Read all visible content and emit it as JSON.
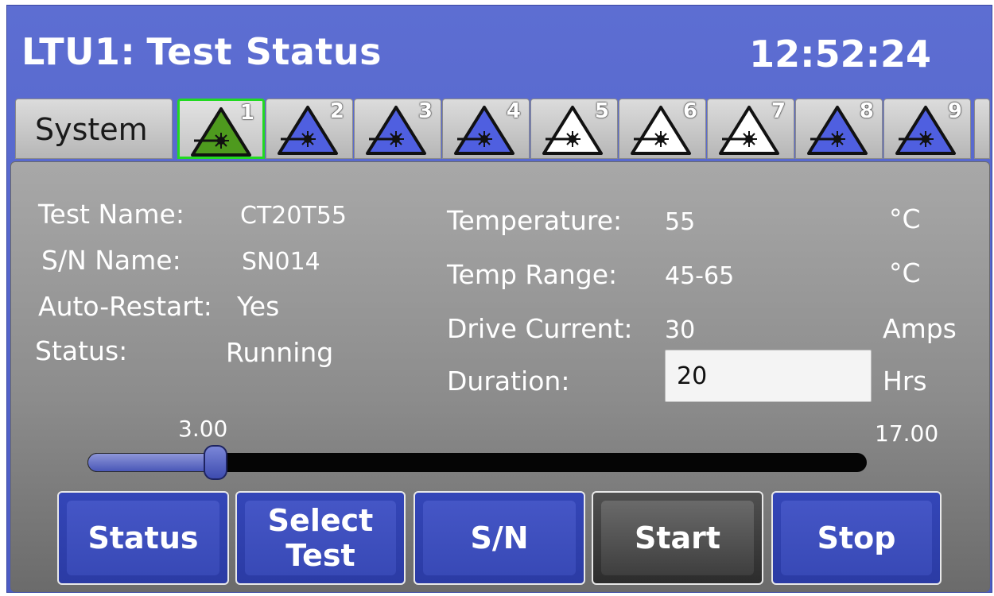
{
  "header": {
    "title_part1": "LTU1:",
    "title_part2": "Test Status",
    "clock": "12:52:24"
  },
  "tabs": {
    "system_label": "System",
    "lasers": [
      {
        "num": "1",
        "color": "#4e9a1e",
        "active": true
      },
      {
        "num": "2",
        "color": "#4f5fe0",
        "active": false
      },
      {
        "num": "3",
        "color": "#4f5fe0",
        "active": false
      },
      {
        "num": "4",
        "color": "#4f5fe0",
        "active": false
      },
      {
        "num": "5",
        "color": "#ffffff",
        "active": false
      },
      {
        "num": "6",
        "color": "#ffffff",
        "active": false
      },
      {
        "num": "7",
        "color": "#ffffff",
        "active": false
      },
      {
        "num": "8",
        "color": "#4f5fe0",
        "active": false
      },
      {
        "num": "9",
        "color": "#4f5fe0",
        "active": false
      }
    ],
    "laser_icon": "laser-warning-icon"
  },
  "info": {
    "test_name_label": "Test Name:",
    "test_name_value": "CT20T55",
    "sn_label": "S/N Name:",
    "sn_value": "SN014",
    "auto_restart_label": "Auto-Restart:",
    "auto_restart_value": "Yes",
    "status_label": "Status:",
    "status_value": "Running"
  },
  "params": {
    "temperature_label": "Temperature:",
    "temperature_value": "55",
    "temperature_unit": "°C",
    "temp_range_label": "Temp Range:",
    "temp_range_value": "45-65",
    "temp_range_unit": "°C",
    "drive_current_label": "Drive Current:",
    "drive_current_value": "30",
    "drive_current_unit": "Amps",
    "duration_label": "Duration:",
    "duration_value": "20",
    "duration_unit": "Hrs"
  },
  "progress": {
    "elapsed_label": "3.00",
    "remaining_label": "17.00",
    "fraction": 0.15
  },
  "buttons": {
    "status": "Status",
    "select_test_line1": "Select",
    "select_test_line2": "Test",
    "sn": "S/N",
    "start": "Start",
    "stop": "Stop"
  }
}
